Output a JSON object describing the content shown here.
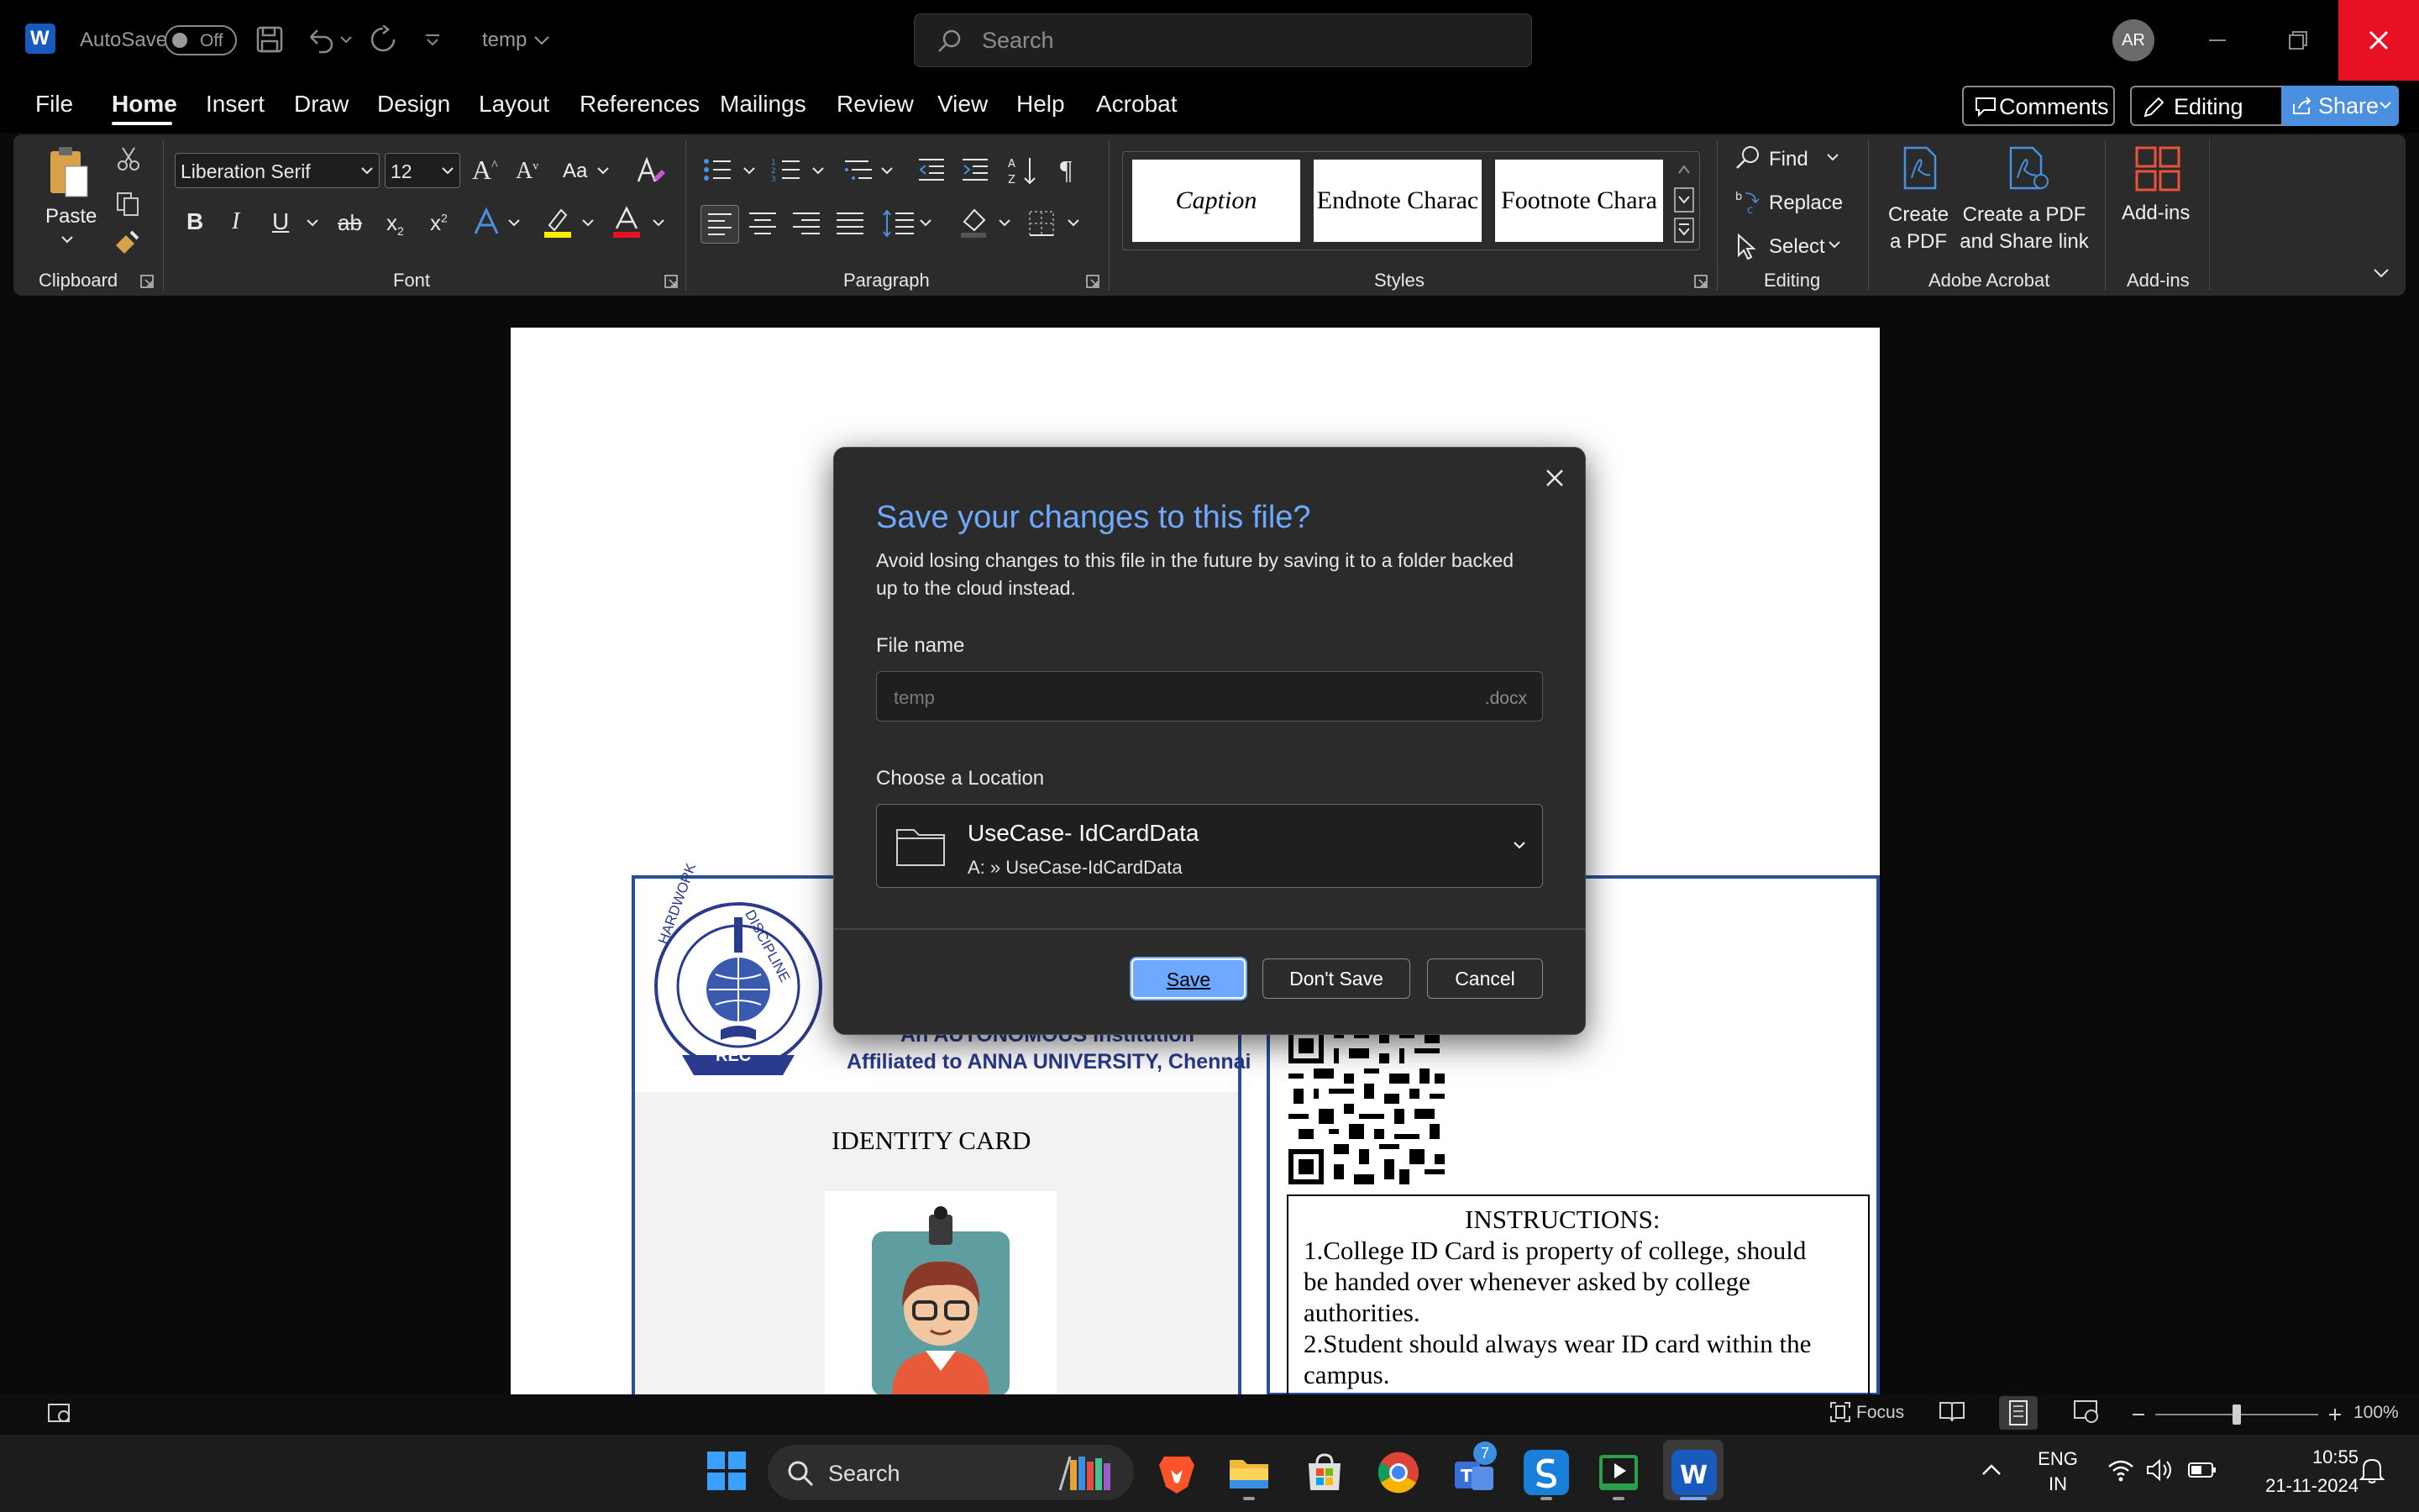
{
  "titlebar": {
    "autosave_label": "AutoSave",
    "autosave_state": "Off",
    "doc_title": "temp",
    "search_placeholder": "Search",
    "user_initials": "AR"
  },
  "menu": {
    "tabs": [
      "File",
      "Home",
      "Insert",
      "Draw",
      "Design",
      "Layout",
      "References",
      "Mailings",
      "Review",
      "View",
      "Help",
      "Acrobat"
    ],
    "active_tab": "Home",
    "comments_label": "Comments",
    "editing_label": "Editing",
    "share_label": "Share"
  },
  "ribbon": {
    "clipboard": {
      "paste_label": "Paste",
      "group_label": "Clipboard"
    },
    "font": {
      "font_name": "Liberation Serif",
      "font_size": "12",
      "case_label": "Aa",
      "group_label": "Font"
    },
    "paragraph": {
      "group_label": "Paragraph"
    },
    "styles": {
      "items": [
        "Caption",
        "Endnote Charac",
        "Footnote Chara"
      ],
      "group_label": "Styles"
    },
    "editing": {
      "find_label": "Find",
      "replace_label": "Replace",
      "select_label": "Select",
      "group_label": "Editing"
    },
    "acrobat": {
      "create_pdf_line1": "Create",
      "create_pdf_line2": "a PDF",
      "share_link_line1": "Create a PDF",
      "share_link_line2": "and Share link",
      "group_label": "Adobe Acrobat"
    },
    "addins": {
      "label": "Add-ins",
      "group_label": "Add-ins"
    }
  },
  "document": {
    "institution_line1": "An AUTONOMOUS Institution",
    "institution_line2": "Affiliated to ANNA UNIVERSITY, Chennai",
    "logo_text": "REC",
    "logo_arc_left": "HARDWORK",
    "logo_arc_right": "DISCIPLINE",
    "identity_card": "IDENTITY CARD",
    "instructions_title": "INSTRUCTIONS:",
    "instructions_lines": [
      "1.College ID Card is property of college, should",
      "be handed over whenever asked by college",
      "authorities.",
      "2.Student should always wear ID card within the",
      "campus."
    ]
  },
  "dialog": {
    "title": "Save your changes to this file?",
    "description": "Avoid losing changes to this file in the future by saving it to a folder backed up to the cloud instead.",
    "file_name_label": "File name",
    "file_name_placeholder": "temp",
    "file_ext": ".docx",
    "location_label": "Choose a Location",
    "location_name": "UseCase- IdCardData",
    "location_path": "A: » UseCase-IdCardData",
    "save_label": "Save",
    "dont_save_label": "Don't Save",
    "cancel_label": "Cancel"
  },
  "statusbar": {
    "focus_label": "Focus",
    "zoom": "100%"
  },
  "taskbar": {
    "search_placeholder": "Search",
    "teams_badge": "7",
    "lang_line1": "ENG",
    "lang_line2": "IN",
    "time": "10:55",
    "date": "21-11-2024"
  },
  "colors": {
    "accent": "#6ea8ff",
    "close_red": "#e81123",
    "card_border": "#2a4f9a",
    "share_blue": "#4a8fe0"
  }
}
